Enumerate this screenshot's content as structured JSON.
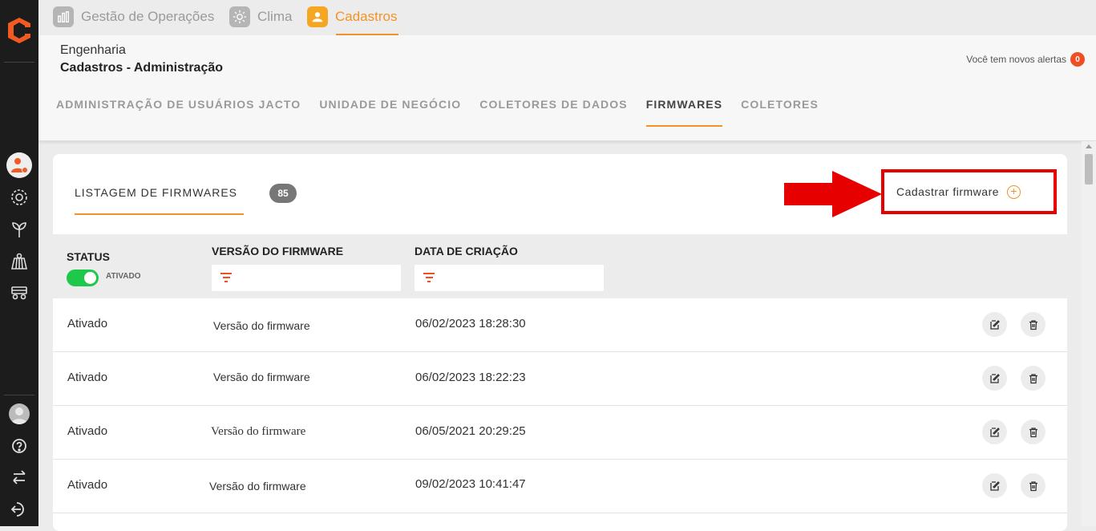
{
  "topbar": {
    "tabs": [
      {
        "label": "Gestão de Operações",
        "icon": "chart-icon"
      },
      {
        "label": "Clima",
        "icon": "sun-icon"
      },
      {
        "label": "Cadastros",
        "icon": "user-icon",
        "active": true
      }
    ]
  },
  "header": {
    "crumb1": "Engenharia",
    "crumb2": "Cadastros - Administração",
    "alerts_text": "Você tem novos alertas",
    "alerts_count": "0"
  },
  "subnav": [
    {
      "label": "ADMINISTRAÇÃO DE USUÁRIOS JACTO"
    },
    {
      "label": "UNIDADE DE NEGÓCIO"
    },
    {
      "label": "COLETORES DE DADOS"
    },
    {
      "label": "FIRMWARES",
      "active": true
    },
    {
      "label": "COLETORES"
    }
  ],
  "list": {
    "tab_label": "LISTAGEM DE FIRMWARES",
    "count": "85",
    "add_label": "Cadastrar firmware"
  },
  "table": {
    "col_status": "STATUS",
    "toggle_label": "ATIVADO",
    "col_version": "VERSÃO DO FIRMWARE",
    "col_date": "DATA DE CRIAÇÃO",
    "rows": [
      {
        "status": "Ativado",
        "version": "Versão do firmware",
        "date": "06/02/2023 18:28:30"
      },
      {
        "status": "Ativado",
        "version": "Versão do firmware",
        "date": "06/02/2023 18:22:23"
      },
      {
        "status": "Ativado",
        "version": "Versão do firmware",
        "date": "06/05/2021 20:29:25"
      },
      {
        "status": "Ativado",
        "version": "Versão do firmware",
        "date": "09/02/2023 10:41:47"
      }
    ]
  },
  "colors": {
    "accent": "#f29325",
    "highlight": "#e60000",
    "toggle_on": "#1ec84b",
    "sidebar": "#1c1c1c"
  }
}
